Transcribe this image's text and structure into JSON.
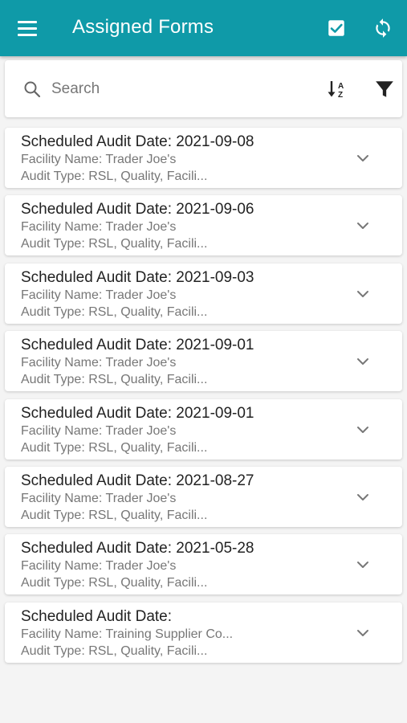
{
  "header": {
    "title": "Assigned Forms",
    "menu_icon": "menu-icon",
    "check_icon": "checkbox-icon",
    "sync_icon": "sync-icon",
    "color": "#0f9aa8"
  },
  "search": {
    "placeholder": "Search",
    "value": "",
    "sort_icon": "sort-alpha-icon",
    "filter_icon": "filter-icon"
  },
  "forms": [
    {
      "title": "Scheduled Audit Date: 2021-09-08",
      "facility": "Facility Name: Trader Joe's",
      "audit_type": "Audit Type: RSL, Quality, Facili..."
    },
    {
      "title": "Scheduled Audit Date: 2021-09-06",
      "facility": "Facility Name: Trader Joe's",
      "audit_type": "Audit Type: RSL, Quality, Facili..."
    },
    {
      "title": "Scheduled Audit Date: 2021-09-03",
      "facility": "Facility Name: Trader Joe's",
      "audit_type": "Audit Type: RSL, Quality, Facili..."
    },
    {
      "title": "Scheduled Audit Date: 2021-09-01",
      "facility": "Facility Name: Trader Joe's",
      "audit_type": "Audit Type: RSL, Quality, Facili..."
    },
    {
      "title": "Scheduled Audit Date: 2021-09-01",
      "facility": "Facility Name: Trader Joe's",
      "audit_type": "Audit Type: RSL, Quality, Facili..."
    },
    {
      "title": "Scheduled Audit Date: 2021-08-27",
      "facility": "Facility Name: Trader Joe's",
      "audit_type": "Audit Type: RSL, Quality, Facili..."
    },
    {
      "title": "Scheduled Audit Date: 2021-05-28",
      "facility": "Facility Name: Trader Joe's",
      "audit_type": "Audit Type: RSL, Quality, Facili..."
    },
    {
      "title": "Scheduled Audit Date:",
      "facility": "Facility Name: Training Supplier Co...",
      "audit_type": "Audit Type: RSL, Quality, Facili..."
    }
  ]
}
